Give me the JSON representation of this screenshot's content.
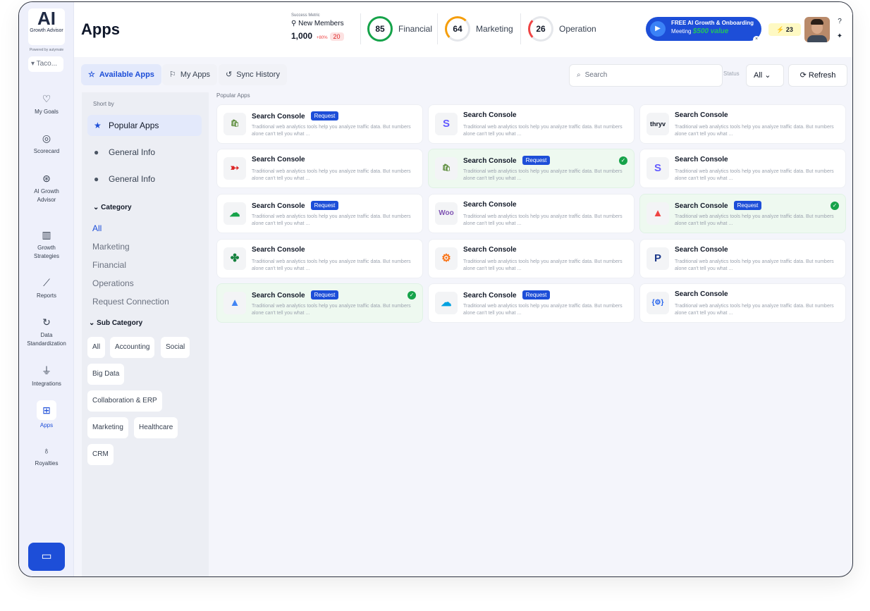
{
  "brand": {
    "logo_ai": "AI",
    "logo_sub": "Growth Advisor",
    "powered": "Powered by autymate",
    "workspace": "Taco..."
  },
  "nav": [
    {
      "label": "My Goals",
      "icon": "heart-pulse-icon"
    },
    {
      "label": "Scorecard",
      "icon": "scorecard-icon"
    },
    {
      "label": "AI Growth Advisor",
      "icon": "brain-icon"
    },
    {
      "label": "Growth Strategies",
      "icon": "books-icon"
    },
    {
      "label": "Reports",
      "icon": "chart-line-icon"
    },
    {
      "label": "Data Standardization",
      "icon": "sync-icon"
    },
    {
      "label": "Integrations",
      "icon": "plug-icon"
    },
    {
      "label": "Apps",
      "icon": "grid-icon"
    },
    {
      "label": "Royalties",
      "icon": "money-bag-icon"
    }
  ],
  "header": {
    "title": "Apps",
    "metric": {
      "small": "Success Metric",
      "name": "New Members",
      "value": "1,000",
      "pct": "+80%",
      "count": "20"
    },
    "scores": [
      {
        "value": "85",
        "label": "Financial",
        "color": "#16a34a"
      },
      {
        "value": "64",
        "label": "Marketing",
        "color": "#f59e0b"
      },
      {
        "value": "26",
        "label": "Operation",
        "color": "#ef4444"
      }
    ],
    "promo": {
      "line1": "FREE AI Growth & Onboarding",
      "line2": "Meeting",
      "amount": "$500 value"
    },
    "credits": "⚡ 23"
  },
  "toolbar": {
    "tabs": [
      "Available Apps",
      "My Apps",
      "Sync History"
    ],
    "search_placeholder": "Search",
    "status_label": "Status",
    "status_value": "All",
    "refresh": "Refresh"
  },
  "filters": {
    "sort_by": "Short by",
    "sort_options": [
      "Popular Apps",
      "General Info",
      "General Info"
    ],
    "category_title": "Category",
    "categories": [
      "All",
      "Marketing",
      "Financial",
      "Operations",
      "Request Connection"
    ],
    "subcategory_title": "Sub Category",
    "subcategories": [
      "All",
      "Accounting",
      "Social",
      "Big Data",
      "Collaboration & ERP",
      "Marketing",
      "Healthcare",
      "CRM"
    ]
  },
  "section_label": "Popular Apps",
  "card_title": "Search Console",
  "card_desc": "Traditional web analytics tools help you analyze traffic data. But numbers alone can't tell you what ...",
  "request_label": "Request",
  "cards": [
    {
      "logo": "shopify-logo",
      "glyph": "🛍",
      "color": "#5e8e3e",
      "request": true,
      "selected": false
    },
    {
      "logo": "stripe-logo",
      "glyph": "S",
      "color": "#635bff",
      "request": false,
      "selected": false
    },
    {
      "logo": "thryv-logo",
      "glyph": "thryv",
      "color": "#111827",
      "request": false,
      "selected": false
    },
    {
      "logo": "redbull-logo",
      "glyph": "➳",
      "color": "#dc2626",
      "request": false,
      "selected": false
    },
    {
      "logo": "shopify-logo",
      "glyph": "🛍",
      "color": "#5e8e3e",
      "request": true,
      "selected": true
    },
    {
      "logo": "stripe-logo",
      "glyph": "S",
      "color": "#635bff",
      "request": false,
      "selected": false
    },
    {
      "logo": "surveymonkey-logo",
      "glyph": "☁",
      "color": "#16a34a",
      "request": true,
      "selected": false
    },
    {
      "logo": "woocommerce-logo",
      "glyph": "Woo",
      "color": "#7f54b3",
      "request": false,
      "selected": false
    },
    {
      "logo": "mountain-logo",
      "glyph": "▲",
      "color": "#ef4444",
      "request": true,
      "selected": true
    },
    {
      "logo": "clover-logo",
      "glyph": "✤",
      "color": "#15803d",
      "request": false,
      "selected": false
    },
    {
      "logo": "hubspot-logo",
      "glyph": "⚙",
      "color": "#f97316",
      "request": false,
      "selected": false
    },
    {
      "logo": "paypal-logo",
      "glyph": "P",
      "color": "#1e3a8a",
      "request": false,
      "selected": false
    },
    {
      "logo": "google-ads-logo",
      "glyph": "▲",
      "color": "#4285f4",
      "request": true,
      "selected": true
    },
    {
      "logo": "salesforce-logo",
      "glyph": "☁",
      "color": "#00a1e0",
      "request": true,
      "selected": false
    },
    {
      "logo": "code-logo",
      "glyph": "{⚙}",
      "color": "#2563eb",
      "request": false,
      "selected": false
    }
  ]
}
